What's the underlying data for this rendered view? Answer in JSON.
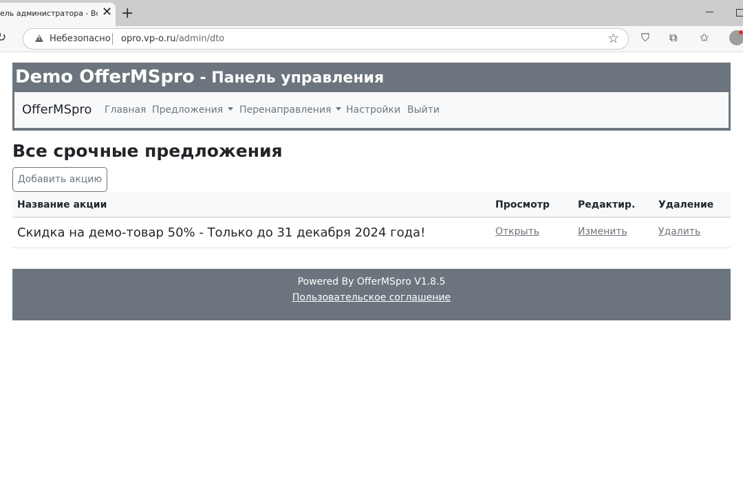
{
  "browser": {
    "tab_title": "ель администратора - Все ср",
    "security_label": "Небезопасно",
    "url_host": "opro.vp-o.ru",
    "url_path": "/admin/dto",
    "icons": [
      "reload-icon",
      "warning-icon",
      "star-icon",
      "shield-icon",
      "extensions-icon",
      "favorites-icon",
      "profile-icon"
    ]
  },
  "header": {
    "brand_title": "Demo OfferMSpro",
    "subtitle": " - Панель управления"
  },
  "navbar": {
    "brand": "OfferMSpro",
    "items": [
      {
        "label": "Главная",
        "dropdown": false
      },
      {
        "label": "Предложения",
        "dropdown": true
      },
      {
        "label": "Перенаправления",
        "dropdown": true
      },
      {
        "label": "Настройки",
        "dropdown": false
      },
      {
        "label": "Выйти",
        "dropdown": false
      }
    ]
  },
  "main": {
    "title": "Все срочные предложения",
    "add_button": "Добавить акцию",
    "table": {
      "headers": [
        "Название акции",
        "Просмотр",
        "Редактир.",
        "Удаление"
      ],
      "rows": [
        {
          "name": "Скидка на демо-товар 50% - Только до 31 декабря 2024 года!",
          "view": "Открыть",
          "edit": "Изменить",
          "delete": "Удалить"
        }
      ]
    }
  },
  "footer": {
    "powered_by": "Powered By OfferMSpro V1.8.5",
    "agreement_link": "Пользовательское соглашение"
  },
  "colors": {
    "header_bg": "#6c757d",
    "navbar_bg": "#f8f9fa",
    "muted_text": "#6c757d"
  }
}
